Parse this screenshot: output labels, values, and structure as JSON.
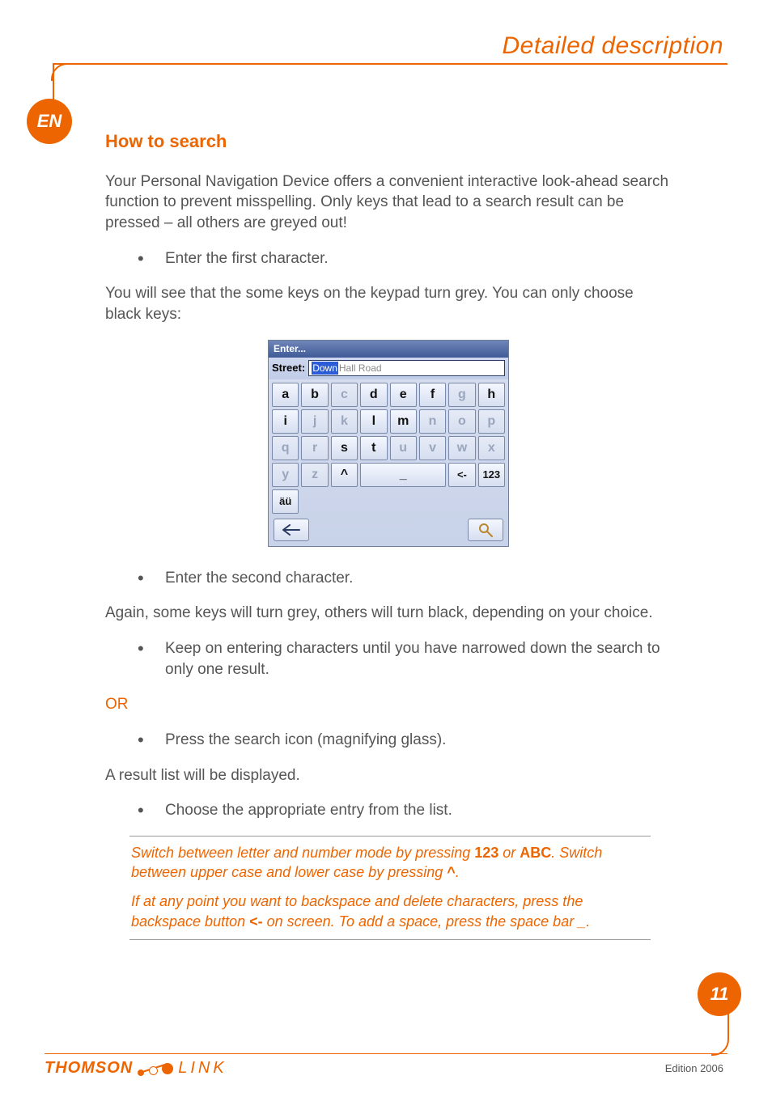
{
  "header": {
    "title": "Detailed description",
    "lang_badge": "EN"
  },
  "section": {
    "heading": "How to search",
    "intro": "Your Personal Navigation Device offers a convenient interactive look-ahead search function to prevent misspelling. Only keys that lead to a search result can be pressed – all others are greyed out!",
    "step1": "Enter the first character.",
    "after_step1": "You will see that the some keys on the keypad turn grey. You can only choose black keys:",
    "step2": "Enter the second character.",
    "after_step2": "Again, some keys will turn grey, others will turn black, depending on your choice.",
    "step3": "Keep on entering characters until you have narrowed down the search to only one result.",
    "or_label": "OR",
    "step_alt": "Press the search icon (magnifying glass).",
    "after_alt": "A result list will be displayed.",
    "step_final": "Choose the appropriate entry from the list."
  },
  "tip": {
    "p1_a": "Switch between letter and number mode by pressing ",
    "b1": "123",
    "p1_b": " or ",
    "b2": "ABC",
    "p1_c": ". Switch between upper case and lower case by pressing ",
    "b3": "^",
    "p1_d": ".",
    "p2_a": "If at any point you want to backspace and delete characters, press the backspace button ",
    "b4": "<-",
    "p2_b": " on screen. To add a space, press the space bar _."
  },
  "device": {
    "title": "Enter...",
    "field_label": "Street:",
    "field_selected": "Down",
    "field_rest": " Hall Road",
    "keys_row1": [
      {
        "l": "a",
        "en": true
      },
      {
        "l": "b",
        "en": true
      },
      {
        "l": "c",
        "en": false
      },
      {
        "l": "d",
        "en": true
      },
      {
        "l": "e",
        "en": true
      },
      {
        "l": "f",
        "en": true
      },
      {
        "l": "g",
        "en": false
      },
      {
        "l": "h",
        "en": true
      }
    ],
    "keys_row2": [
      {
        "l": "i",
        "en": true
      },
      {
        "l": "j",
        "en": false
      },
      {
        "l": "k",
        "en": false
      },
      {
        "l": "l",
        "en": true
      },
      {
        "l": "m",
        "en": true
      },
      {
        "l": "n",
        "en": false
      },
      {
        "l": "o",
        "en": false
      },
      {
        "l": "p",
        "en": false
      }
    ],
    "keys_row3": [
      {
        "l": "q",
        "en": false
      },
      {
        "l": "r",
        "en": false
      },
      {
        "l": "s",
        "en": true
      },
      {
        "l": "t",
        "en": true
      },
      {
        "l": "u",
        "en": false
      },
      {
        "l": "v",
        "en": false
      },
      {
        "l": "w",
        "en": false
      },
      {
        "l": "x",
        "en": false
      }
    ],
    "keys_row4": {
      "y": {
        "l": "y",
        "en": false
      },
      "z": {
        "l": "z",
        "en": false
      },
      "shift": {
        "l": "^",
        "en": true
      },
      "space": {
        "l": "_",
        "en": true
      },
      "back": {
        "l": "<-",
        "en": true
      },
      "num": {
        "l": "123",
        "en": true
      },
      "acc": {
        "l": "äü",
        "en": true
      }
    }
  },
  "footer": {
    "page_number": "11",
    "edition": "Edition 2006",
    "logo_a": "THOMSON",
    "logo_b": "LINK"
  }
}
